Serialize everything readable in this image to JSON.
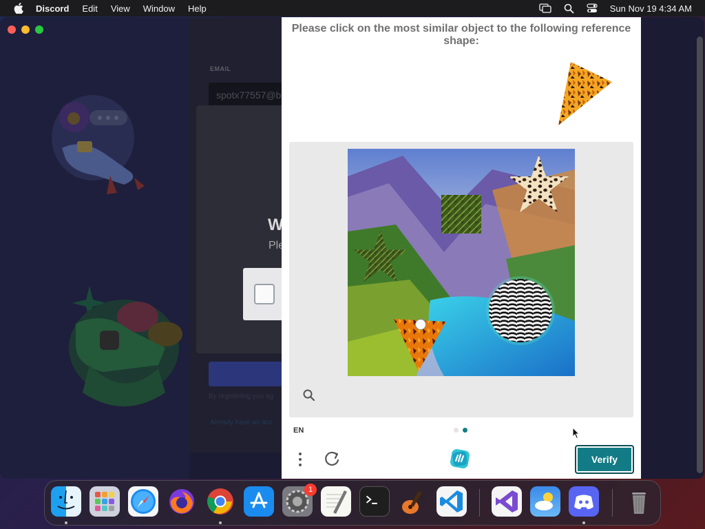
{
  "menubar": {
    "app_name": "Discord",
    "menus": [
      "Edit",
      "View",
      "Window",
      "Help"
    ],
    "clock": "Sun Nov 19  4:34 AM",
    "status_icons": [
      "screen-mirroring-icon",
      "spotlight-search-icon",
      "control-center-icon"
    ]
  },
  "discord_window": {
    "email_label": "EMAIL",
    "email_value": "spotx77557@b",
    "modal_title": "W",
    "modal_subtitle": "Ple",
    "tiny_text_1": "By registering you ag",
    "tiny_text_2": "Already have an acc"
  },
  "challenge": {
    "prompt": "Please click on the most similar object to the following reference shape:",
    "reference_shape": "triangle",
    "shapes": [
      "star",
      "square",
      "star",
      "circle",
      "triangle"
    ],
    "language": "EN",
    "pages": 2,
    "current_page": 2,
    "verify_label": "Verify"
  },
  "dock": {
    "items": [
      {
        "name": "Finder",
        "icon": "finder-icon",
        "running": true
      },
      {
        "name": "Launchpad",
        "icon": "launchpad-icon",
        "running": false
      },
      {
        "name": "Safari",
        "icon": "safari-icon",
        "running": false
      },
      {
        "name": "Firefox",
        "icon": "firefox-icon",
        "running": false
      },
      {
        "name": "Google Chrome",
        "icon": "chrome-icon",
        "running": true
      },
      {
        "name": "App Store",
        "icon": "app-store-icon",
        "running": false
      },
      {
        "name": "System Settings",
        "icon": "system-settings-icon",
        "running": false,
        "badge": "1"
      },
      {
        "name": "TextEdit",
        "icon": "textedit-icon",
        "running": false
      },
      {
        "name": "Terminal",
        "icon": "terminal-icon",
        "running": false
      },
      {
        "name": "GarageBand",
        "icon": "garageband-icon",
        "running": false
      },
      {
        "name": "Visual Studio Code",
        "icon": "vscode-icon",
        "running": false
      },
      {
        "name": "Visual Studio",
        "icon": "visual-studio-icon",
        "running": false
      },
      {
        "name": "Weather",
        "icon": "weather-icon",
        "running": false
      },
      {
        "name": "Discord",
        "icon": "discord-icon",
        "running": true
      },
      {
        "name": "Trash",
        "icon": "trash-icon",
        "running": false
      }
    ],
    "system_settings_badge": "1"
  },
  "colors": {
    "verify": "#137b85",
    "pager_active": "#0f7e86",
    "menubar": "#1c1c1e"
  }
}
